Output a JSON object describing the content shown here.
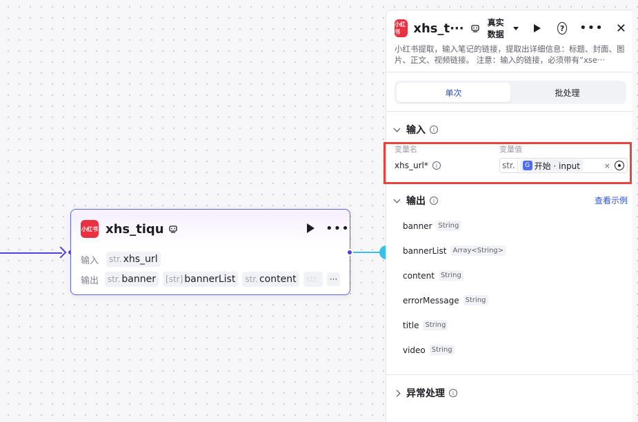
{
  "node": {
    "title": "xhs_tiqu",
    "logo_text": "小红书",
    "input_label": "输入",
    "output_label": "输出",
    "inputs": [
      {
        "type": "str.",
        "name": "xhs_url"
      }
    ],
    "outputs": [
      {
        "type": "str.",
        "name": "banner"
      },
      {
        "type": "[str]",
        "name": "bannerList"
      },
      {
        "type": "str.",
        "name": "content"
      },
      {
        "type": "str.",
        "name": ""
      }
    ],
    "more_label": "···"
  },
  "panel": {
    "title": "xhs_t···",
    "logo_text": "小红书",
    "mode_label": "真实数据",
    "description": "小红书提取，输入笔记的链接，提取出详细信息：标题、封面、图片、正文、视频链接。 注意：输入的链接，必须带有“xse···",
    "tabs": [
      {
        "label": "单次"
      },
      {
        "label": "批处理"
      }
    ],
    "input_section": {
      "title": "输入",
      "col_name": "变量名",
      "col_value": "变量值",
      "var_name": "xhs_url*",
      "var_type": "str.",
      "ref_icon": "G",
      "ref_text": "开始 · input",
      "clear": "×"
    },
    "output_section": {
      "title": "输出",
      "example_link": "查看示例",
      "items": [
        {
          "name": "banner",
          "type": "String"
        },
        {
          "name": "bannerList",
          "type": "Array<String>"
        },
        {
          "name": "content",
          "type": "String"
        },
        {
          "name": "errorMessage",
          "type": "String"
        },
        {
          "name": "title",
          "type": "String"
        },
        {
          "name": "video",
          "type": "String"
        }
      ]
    },
    "error_section": {
      "title": "异常处理"
    }
  },
  "colors": {
    "accent": "#4e40e5",
    "link": "#2b50e6",
    "highlight": "#e8423f",
    "brand": "#e93141"
  }
}
